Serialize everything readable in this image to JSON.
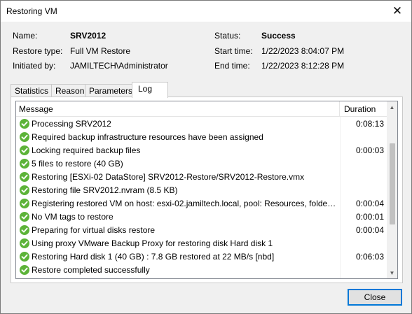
{
  "window": {
    "title": "Restoring VM"
  },
  "info": {
    "name_label": "Name:",
    "name_value": "SRV2012",
    "restore_type_label": "Restore type:",
    "restore_type_value": "Full VM Restore",
    "initiated_label": "Initiated by:",
    "initiated_value": "JAMILTECH\\Administrator",
    "status_label": "Status:",
    "status_value": "Success",
    "start_label": "Start time:",
    "start_value": "1/22/2023 8:04:07 PM",
    "end_label": "End time:",
    "end_value": "1/22/2023 8:12:28 PM"
  },
  "tabs": [
    "Statistics",
    "Reason",
    "Parameters",
    "Log"
  ],
  "active_tab": "Log",
  "log": {
    "columns": {
      "message": "Message",
      "duration": "Duration"
    },
    "rows": [
      {
        "message": "Processing SRV2012",
        "duration": "0:08:13"
      },
      {
        "message": "Required backup infrastructure resources have been assigned",
        "duration": ""
      },
      {
        "message": "Locking required backup files",
        "duration": "0:00:03"
      },
      {
        "message": "5 files to restore (40 GB)",
        "duration": ""
      },
      {
        "message": "Restoring [ESXi-02 DataStore] SRV2012-Restore/SRV2012-Restore.vmx",
        "duration": ""
      },
      {
        "message": "Restoring file SRV2012.nvram (8.5 KB)",
        "duration": ""
      },
      {
        "message": "Registering restored VM on host: esxi-02.jamiltech.local, pool: Resources, folder: ...",
        "duration": "0:00:04"
      },
      {
        "message": "No VM tags to restore",
        "duration": "0:00:01"
      },
      {
        "message": "Preparing for virtual disks restore",
        "duration": "0:00:04"
      },
      {
        "message": "Using proxy VMware Backup Proxy for restoring disk Hard disk 1",
        "duration": ""
      },
      {
        "message": "Restoring Hard disk 1 (40 GB) : 7.8 GB restored at 22 MB/s  [nbd]",
        "duration": "0:06:03"
      },
      {
        "message": "Restore completed successfully",
        "duration": ""
      }
    ],
    "status_icon": "success-check-icon",
    "status_color": "#5cb338"
  },
  "buttons": {
    "close": "Close"
  },
  "colors": {
    "accent": "#0078d7"
  }
}
